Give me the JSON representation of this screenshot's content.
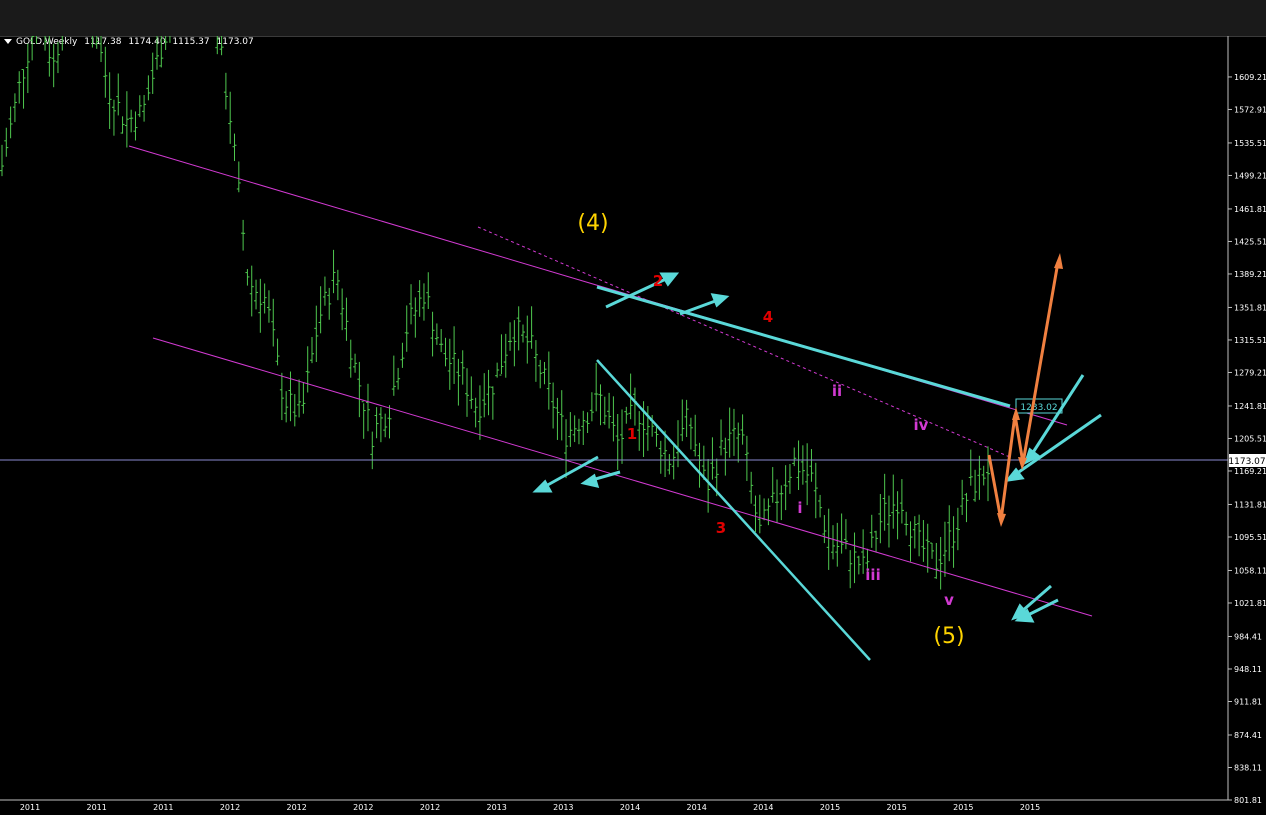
{
  "window": {
    "title": ""
  },
  "header": {
    "symbol": "GOLD,Weekly",
    "open": "1117.38",
    "high": "1174.40",
    "low": "1115.37",
    "close": "1173.07"
  },
  "chart_data": {
    "type": "bar",
    "symbol": "GOLD",
    "timeframe": "Weekly",
    "ylim": [
      801.81,
      1646
    ],
    "y_ticks": [
      "1609.21",
      "1572.91",
      "1535.51",
      "1499.21",
      "1461.81",
      "1425.51",
      "1389.21",
      "1351.81",
      "1315.51",
      "1279.21",
      "1241.81",
      "1205.51",
      "1169.21",
      "1131.81",
      "1095.51",
      "1058.11",
      "1021.81",
      "984.41",
      "948.11",
      "911.81",
      "874.41",
      "838.11",
      "801.81"
    ],
    "current_price_label": "1173.07",
    "level_label": "1233.02",
    "x_ticks": [
      "2011",
      "2011",
      "2011",
      "2012",
      "2012",
      "2012",
      "2012",
      "2013",
      "2013",
      "2014",
      "2014",
      "2014",
      "2015",
      "2015",
      "2015",
      "2015"
    ],
    "waves": {
      "primary": [
        "(4)",
        "(5)"
      ],
      "minor": [
        "1",
        "2",
        "3",
        "4"
      ],
      "minute": [
        "i",
        "ii",
        "iii",
        "iv",
        "v"
      ]
    },
    "price_path_x_weeks": [
      0,
      4,
      8,
      12,
      16,
      20,
      24,
      28,
      32,
      36,
      40,
      44,
      48,
      52,
      56,
      60,
      64,
      68,
      72,
      76,
      80,
      84,
      88,
      92,
      96,
      100,
      104,
      108,
      112,
      116,
      120,
      124,
      128,
      132,
      136,
      140,
      144,
      148,
      152,
      156,
      160,
      164,
      168,
      172,
      176,
      180,
      184,
      188,
      192,
      196,
      200,
      204,
      208,
      212,
      216,
      220,
      224
    ],
    "price_path_close": [
      1510,
      1600,
      1680,
      1620,
      1760,
      1690,
      1600,
      1560,
      1570,
      1640,
      1700,
      1720,
      1690,
      1560,
      1380,
      1360,
      1250,
      1230,
      1340,
      1390,
      1290,
      1210,
      1240,
      1330,
      1370,
      1300,
      1280,
      1240,
      1270,
      1330,
      1310,
      1260,
      1210,
      1230,
      1250,
      1200,
      1240,
      1210,
      1180,
      1230,
      1150,
      1200,
      1210,
      1100,
      1140,
      1180,
      1160,
      1090,
      1080,
      1060,
      1120,
      1140,
      1090,
      1065,
      1100,
      1150,
      1173
    ],
    "colors": {
      "background": "#000000",
      "bars": "#4fc84f",
      "channel": "#d23ad2",
      "trendline": "#5ad8d8",
      "projection": "#f08040",
      "primary_labels": "#ffd400",
      "minor_labels": "#e00000",
      "minute_labels": "#d23ad2"
    }
  }
}
